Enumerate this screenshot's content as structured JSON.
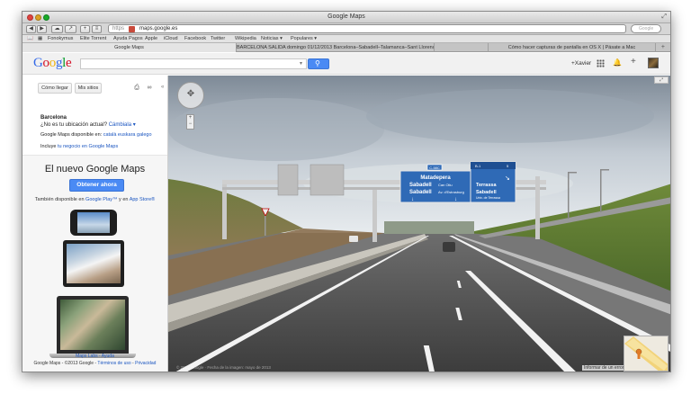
{
  "window": {
    "title": "Google Maps"
  },
  "toolbar": {
    "protocol": "https",
    "url": "maps.google.es",
    "search_placeholder": "Google"
  },
  "bookmarks": [
    "Fonokymus",
    "Elite Torrent",
    "Ayuda Pagos",
    "Apple",
    "iCloud",
    "Facebook",
    "Twitter",
    "Wikipedia",
    "Noticias ▾",
    "Populares ▾"
  ],
  "tabs": [
    {
      "label": "Google Maps",
      "active": true
    },
    {
      "label": "BARCELONA SALIDA domingo 01/12/2013 Barcelona–Sabadell–Talamanca–Sant Llorenç",
      "active": false
    },
    {
      "label": "",
      "active": false
    },
    {
      "label": "Cómo hacer capturas de pantalla en OS X | Pásate a Mac",
      "active": false
    }
  ],
  "google": {
    "logo_letters": [
      {
        "ch": "G",
        "color": "#3369e8"
      },
      {
        "ch": "o",
        "color": "#d50f25"
      },
      {
        "ch": "o",
        "color": "#eeb211"
      },
      {
        "ch": "g",
        "color": "#3369e8"
      },
      {
        "ch": "l",
        "color": "#009925"
      },
      {
        "ch": "e",
        "color": "#d50f25"
      }
    ],
    "search_value": "",
    "user": "+Xavier"
  },
  "leftpanel": {
    "directions_label": "Cómo llegar",
    "my_places_label": "Mis sitios",
    "city": "Barcelona",
    "location_question": "¿No es tu ubicación actual?",
    "change_link": "Cámbiala ▾",
    "available_in": "Google Maps disponible en:",
    "languages": "català euskara galego",
    "business_prefix": "Incluye",
    "business_link": "tu negocio en Google Maps",
    "promo_title": "El nuevo Google Maps",
    "promo_button": "Obtener ahora",
    "also_available": "También disponible en",
    "google_play": "Google Play™",
    "and_in": "y en",
    "app_store": "App Store®",
    "footer_links": "Maps Labs - Ayuda",
    "footer_brand": "Google Maps",
    "footer_copyright": "- ©2013 Google -",
    "footer_terms": "Términos de uso",
    "footer_privacy": "Privacidad"
  },
  "streetview": {
    "sign_left": {
      "badge": "C-58C",
      "line1": "Matadepera",
      "line2": "Sabadell",
      "line2_extra": "Can Oliu",
      "line3": "Sabadell",
      "line3_extra": "Av. d'Estrasburg"
    },
    "sign_right": {
      "badge": "B-1",
      "exit_km": "5",
      "line1": "Terrassa",
      "line2": "Sabadell",
      "line3": "Univ. de Terrassa"
    },
    "copyright": "© 2013 Google · Fecha de la imagen: mayo de 2013",
    "report_label": "Informar de un error"
  }
}
